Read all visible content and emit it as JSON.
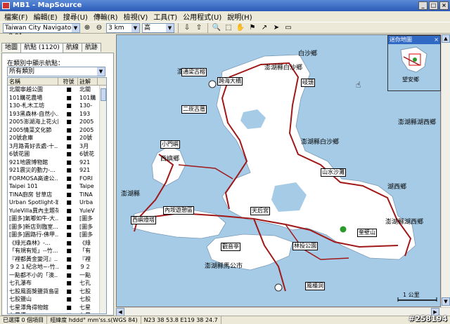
{
  "window": {
    "title": "MB1 - MapSource"
  },
  "menu": [
    "檔案(F)",
    "編輯(E)",
    "搜尋(U)",
    "傳輸(R)",
    "檢視(V)",
    "工具(T)",
    "公用程式(U)",
    "說明(H)"
  ],
  "toolbar": {
    "product": "Taiwan City Navigator v8.01",
    "scale": "3 km",
    "detail": "高"
  },
  "sidebar": {
    "tabs": [
      "地圖",
      "航點 (1120)",
      "航線",
      "航跡"
    ],
    "category_label": "在類別中顯示航點：",
    "category_value": "所有類別",
    "columns": [
      "名稱",
      "符號",
      "註解"
    ],
    "rows": [
      {
        "name": "北關寧越公園",
        "note": "北關"
      },
      {
        "name": "101購花農場",
        "note": "101購"
      },
      {
        "name": "130-札木工坊",
        "note": "130-"
      },
      {
        "name": "193黑森林-自然小...",
        "note": "193"
      },
      {
        "name": "2005澎湖海上花火節",
        "note": "2005"
      },
      {
        "name": "2005情菜文化節",
        "note": "2005"
      },
      {
        "name": "20號倉庫",
        "note": "20號"
      },
      {
        "name": "3月路青好去處-十...",
        "note": "3月"
      },
      {
        "name": "6號花圃",
        "note": "6號花"
      },
      {
        "name": "921地震博物館",
        "note": "921"
      },
      {
        "name": "921震災的動力-...",
        "note": "921"
      },
      {
        "name": "FORMOSA高速公...",
        "note": "FORI"
      },
      {
        "name": "Taipei 101",
        "note": "Taipe"
      },
      {
        "name": "TINA廚房 甘草店",
        "note": "TINA"
      },
      {
        "name": "Urban Spotlight-城...",
        "note": "Urba"
      },
      {
        "name": "YuleVilla異內主題花...",
        "note": "YuleV"
      },
      {
        "name": "[圖多]氣嘟如牛-大...",
        "note": "[圖多"
      },
      {
        "name": "[圖多]新店到臨室...",
        "note": "[圖多"
      },
      {
        "name": "[圖多]圓路行-佛甲...",
        "note": "[圖多"
      },
      {
        "name": "《綠光森林》-...",
        "note": "《綠"
      },
      {
        "name": "「有規有矩」--竹...",
        "note": "「有"
      },
      {
        "name": "『裡都黃金變河』...",
        "note": "『裡"
      },
      {
        "name": "９２１紀念地~-竹...",
        "note": "９２"
      },
      {
        "name": "一點都不小的「澳...",
        "note": "一點"
      },
      {
        "name": "七孔瀑布",
        "note": "七孔"
      },
      {
        "name": "七股風面獎鹽貨島區",
        "note": "七股"
      },
      {
        "name": "七股鹽山",
        "note": "七股"
      },
      {
        "name": "七星潭角得物館",
        "note": "七星"
      },
      {
        "name": "七星潭",
        "note": "七星"
      }
    ]
  },
  "map": {
    "labels": [
      {
        "text": "白沙鄉",
        "box": false
      },
      {
        "text": "澎湖縣白沙鄉",
        "box": false
      },
      {
        "text": "澎湖縣湖西鄉",
        "box": false
      },
      {
        "text": "湖西鄉",
        "box": false
      },
      {
        "text": "澎湖縣湖西鄉",
        "box": false
      },
      {
        "text": "澎湖縣馬公市",
        "box": false
      },
      {
        "text": "西嶼鄉",
        "box": false
      },
      {
        "text": "澎湖縣",
        "box": false
      },
      {
        "text": "澎湖縣",
        "box": false
      },
      {
        "text": "通梁古榕",
        "box": true
      },
      {
        "text": "跨海大橋",
        "box": true
      },
      {
        "text": "二崁古厝",
        "box": true
      },
      {
        "text": "西嶼燈塔",
        "box": true
      },
      {
        "text": "觀音亭",
        "box": true
      },
      {
        "text": "天后宮",
        "box": true
      },
      {
        "text": "林投公園",
        "box": true
      },
      {
        "text": "風櫃洞",
        "box": true
      },
      {
        "text": "山水沙灘",
        "box": true
      },
      {
        "text": "奎壁山",
        "box": true
      },
      {
        "text": "岐頭",
        "box": true
      },
      {
        "text": "內垵遊憩區",
        "box": true
      },
      {
        "text": "小門嶼",
        "box": true
      }
    ],
    "scale_label": "1 公里"
  },
  "minimap": {
    "title": "迷你地圖",
    "label": "望安鄉"
  },
  "status": {
    "selection": "已選擇 0 個項目",
    "coord_format": "經緯度 hddd° mm'ss.s(WGS 84)",
    "coords": "N23 38 53.8 E119 38 24.7"
  },
  "watermark": "#258194",
  "colors": {
    "sea": "#a6cbe6",
    "land": "#ffffff",
    "road": "#a01818"
  }
}
